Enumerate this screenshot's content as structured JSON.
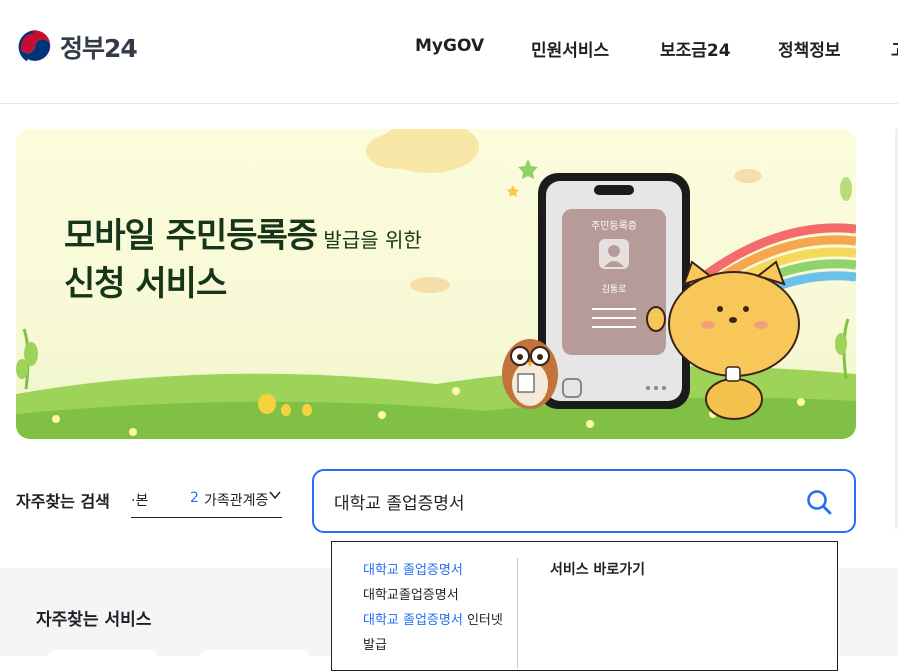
{
  "header": {
    "logo_text": "정부24",
    "nav": [
      "MyGOV",
      "민원서비스",
      "보조금24",
      "정책정보",
      "고"
    ]
  },
  "banner": {
    "title_main": "모바일 주민등록증",
    "title_small": " 발급을 위한",
    "title_line2": "신청 서비스",
    "card_title": "주민등록증",
    "card_name": "김통로"
  },
  "faq_search": {
    "label": "자주찾는 검색",
    "prev_keyword": "·본",
    "current_rank": "2",
    "current_keyword": "가족관계증명서"
  },
  "search": {
    "value": "대학교 졸업증명서"
  },
  "autocomplete": {
    "suggestions": [
      {
        "highlight": "대학교 졸업증명서",
        "rest": ""
      },
      {
        "highlight": "",
        "rest": "대학교졸업증명서"
      },
      {
        "highlight": "대학교 졸업증명서",
        "rest": " 인터넷 발급"
      }
    ],
    "shortcut_title": "서비스 바로가기"
  },
  "lower": {
    "title": "자주찾는 서비스"
  },
  "colors": {
    "accent": "#256ef4",
    "text": "#1e2124",
    "banner_title": "#17351b"
  }
}
